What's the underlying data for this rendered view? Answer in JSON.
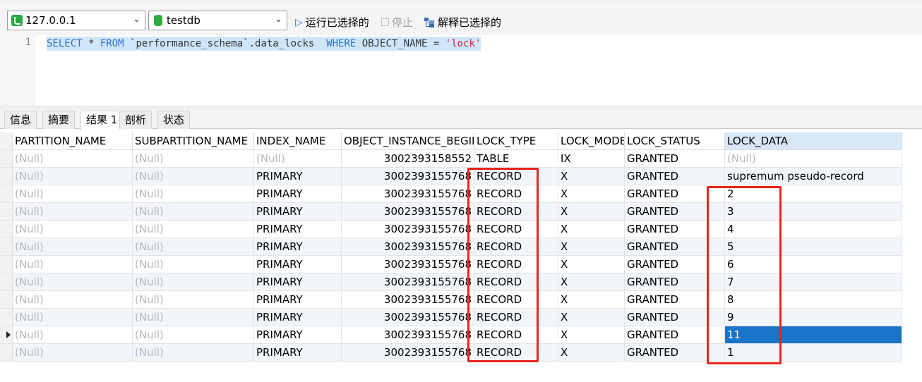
{
  "connection": {
    "host": "127.0.0.1",
    "database": "testdb"
  },
  "toolbar": {
    "run_selected_label": "运行已选择的",
    "stop_label": "停止",
    "explain_selected_label": "解释已选择的"
  },
  "editor": {
    "line_number": "1",
    "sql_parts": [
      "SELECT",
      " * ",
      "FROM",
      " `performance_schema`.data_locks  ",
      "WHERE",
      " OBJECT_NAME = ",
      "'lock'"
    ]
  },
  "tabs": [
    "信息",
    "摘要",
    "结果 1",
    "剖析",
    "状态"
  ],
  "active_tab": "结果 1",
  "grid": {
    "columns": [
      "PARTITION_NAME",
      "SUBPARTITION_NAME",
      "INDEX_NAME",
      "OBJECT_INSTANCE_BEGIN",
      "LOCK_TYPE",
      "LOCK_MODE",
      "LOCK_STATUS",
      "LOCK_DATA"
    ],
    "selected_column": "LOCK_DATA",
    "current_row": 10,
    "rows": [
      [
        "(Null)",
        "(Null)",
        "(Null)",
        "3002393158552",
        "TABLE",
        "IX",
        "GRANTED",
        "(Null)"
      ],
      [
        "(Null)",
        "(Null)",
        "PRIMARY",
        "3002393155768",
        "RECORD",
        "X",
        "GRANTED",
        "supremum pseudo-record"
      ],
      [
        "(Null)",
        "(Null)",
        "PRIMARY",
        "3002393155768",
        "RECORD",
        "X",
        "GRANTED",
        "2"
      ],
      [
        "(Null)",
        "(Null)",
        "PRIMARY",
        "3002393155768",
        "RECORD",
        "X",
        "GRANTED",
        "3"
      ],
      [
        "(Null)",
        "(Null)",
        "PRIMARY",
        "3002393155768",
        "RECORD",
        "X",
        "GRANTED",
        "4"
      ],
      [
        "(Null)",
        "(Null)",
        "PRIMARY",
        "3002393155768",
        "RECORD",
        "X",
        "GRANTED",
        "5"
      ],
      [
        "(Null)",
        "(Null)",
        "PRIMARY",
        "3002393155768",
        "RECORD",
        "X",
        "GRANTED",
        "6"
      ],
      [
        "(Null)",
        "(Null)",
        "PRIMARY",
        "3002393155768",
        "RECORD",
        "X",
        "GRANTED",
        "7"
      ],
      [
        "(Null)",
        "(Null)",
        "PRIMARY",
        "3002393155768",
        "RECORD",
        "X",
        "GRANTED",
        "8"
      ],
      [
        "(Null)",
        "(Null)",
        "PRIMARY",
        "3002393155768",
        "RECORD",
        "X",
        "GRANTED",
        "9"
      ],
      [
        "(Null)",
        "(Null)",
        "PRIMARY",
        "3002393155768",
        "RECORD",
        "X",
        "GRANTED",
        "11"
      ],
      [
        "(Null)",
        "(Null)",
        "PRIMARY",
        "3002393155768",
        "RECORD",
        "X",
        "GRANTED",
        "1"
      ]
    ]
  },
  "colors": {
    "keyword": "#2d6fd1",
    "string": "#d0273b",
    "selection": "#1a74c9",
    "annotation": "#e8241c"
  }
}
